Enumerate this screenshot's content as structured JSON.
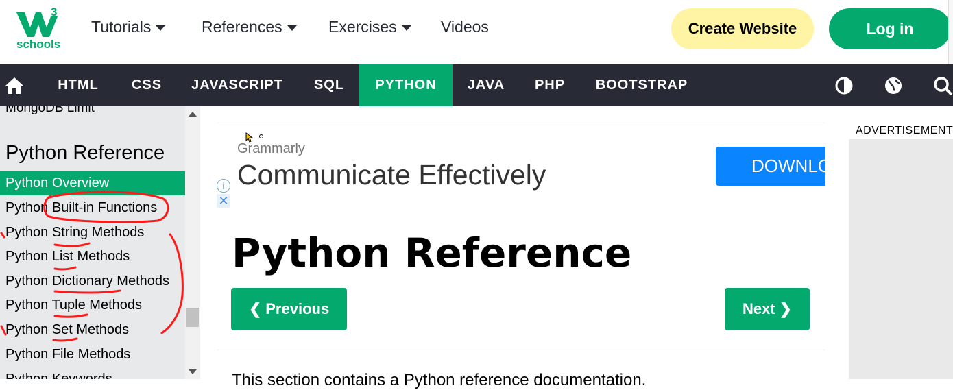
{
  "header": {
    "logo_superscript": "3",
    "logo_text": "schools",
    "nav": [
      {
        "label": "Tutorials"
      },
      {
        "label": "References"
      },
      {
        "label": "Exercises"
      },
      {
        "label": "Videos"
      }
    ],
    "create_website_label": "Create Website",
    "login_label": "Log in"
  },
  "navbar": {
    "items": [
      "HTML",
      "CSS",
      "JAVASCRIPT",
      "SQL",
      "PYTHON",
      "JAVA",
      "PHP",
      "BOOTSTRAP"
    ],
    "active": "PYTHON",
    "icons": [
      "home-icon",
      "contrast-icon",
      "globe-icon",
      "search-icon"
    ]
  },
  "sidebar": {
    "cut_item": "MongoDB Limit",
    "heading": "Python Reference",
    "items": [
      "Python Overview",
      "Python Built-in Functions",
      "Python String Methods",
      "Python List Methods",
      "Python Dictionary Methods",
      "Python Tuple Methods",
      "Python Set Methods",
      "Python File Methods",
      "Python Keywords"
    ],
    "active_item": "Python Overview"
  },
  "ad": {
    "brand": "Grammarly",
    "headline": "Communicate Effectively",
    "button": "DOWNLO"
  },
  "main": {
    "title": "Python Reference",
    "prev_label": "Previous",
    "next_label": "Next",
    "body_text": "This section contains a Python reference documentation."
  },
  "right": {
    "advertisement_label": "ADVERTISEMENT"
  },
  "colors": {
    "green": "#04aa6d",
    "dark": "#282a35",
    "yellow": "#fff4a3",
    "annotation_red": "#ff1a1a"
  }
}
